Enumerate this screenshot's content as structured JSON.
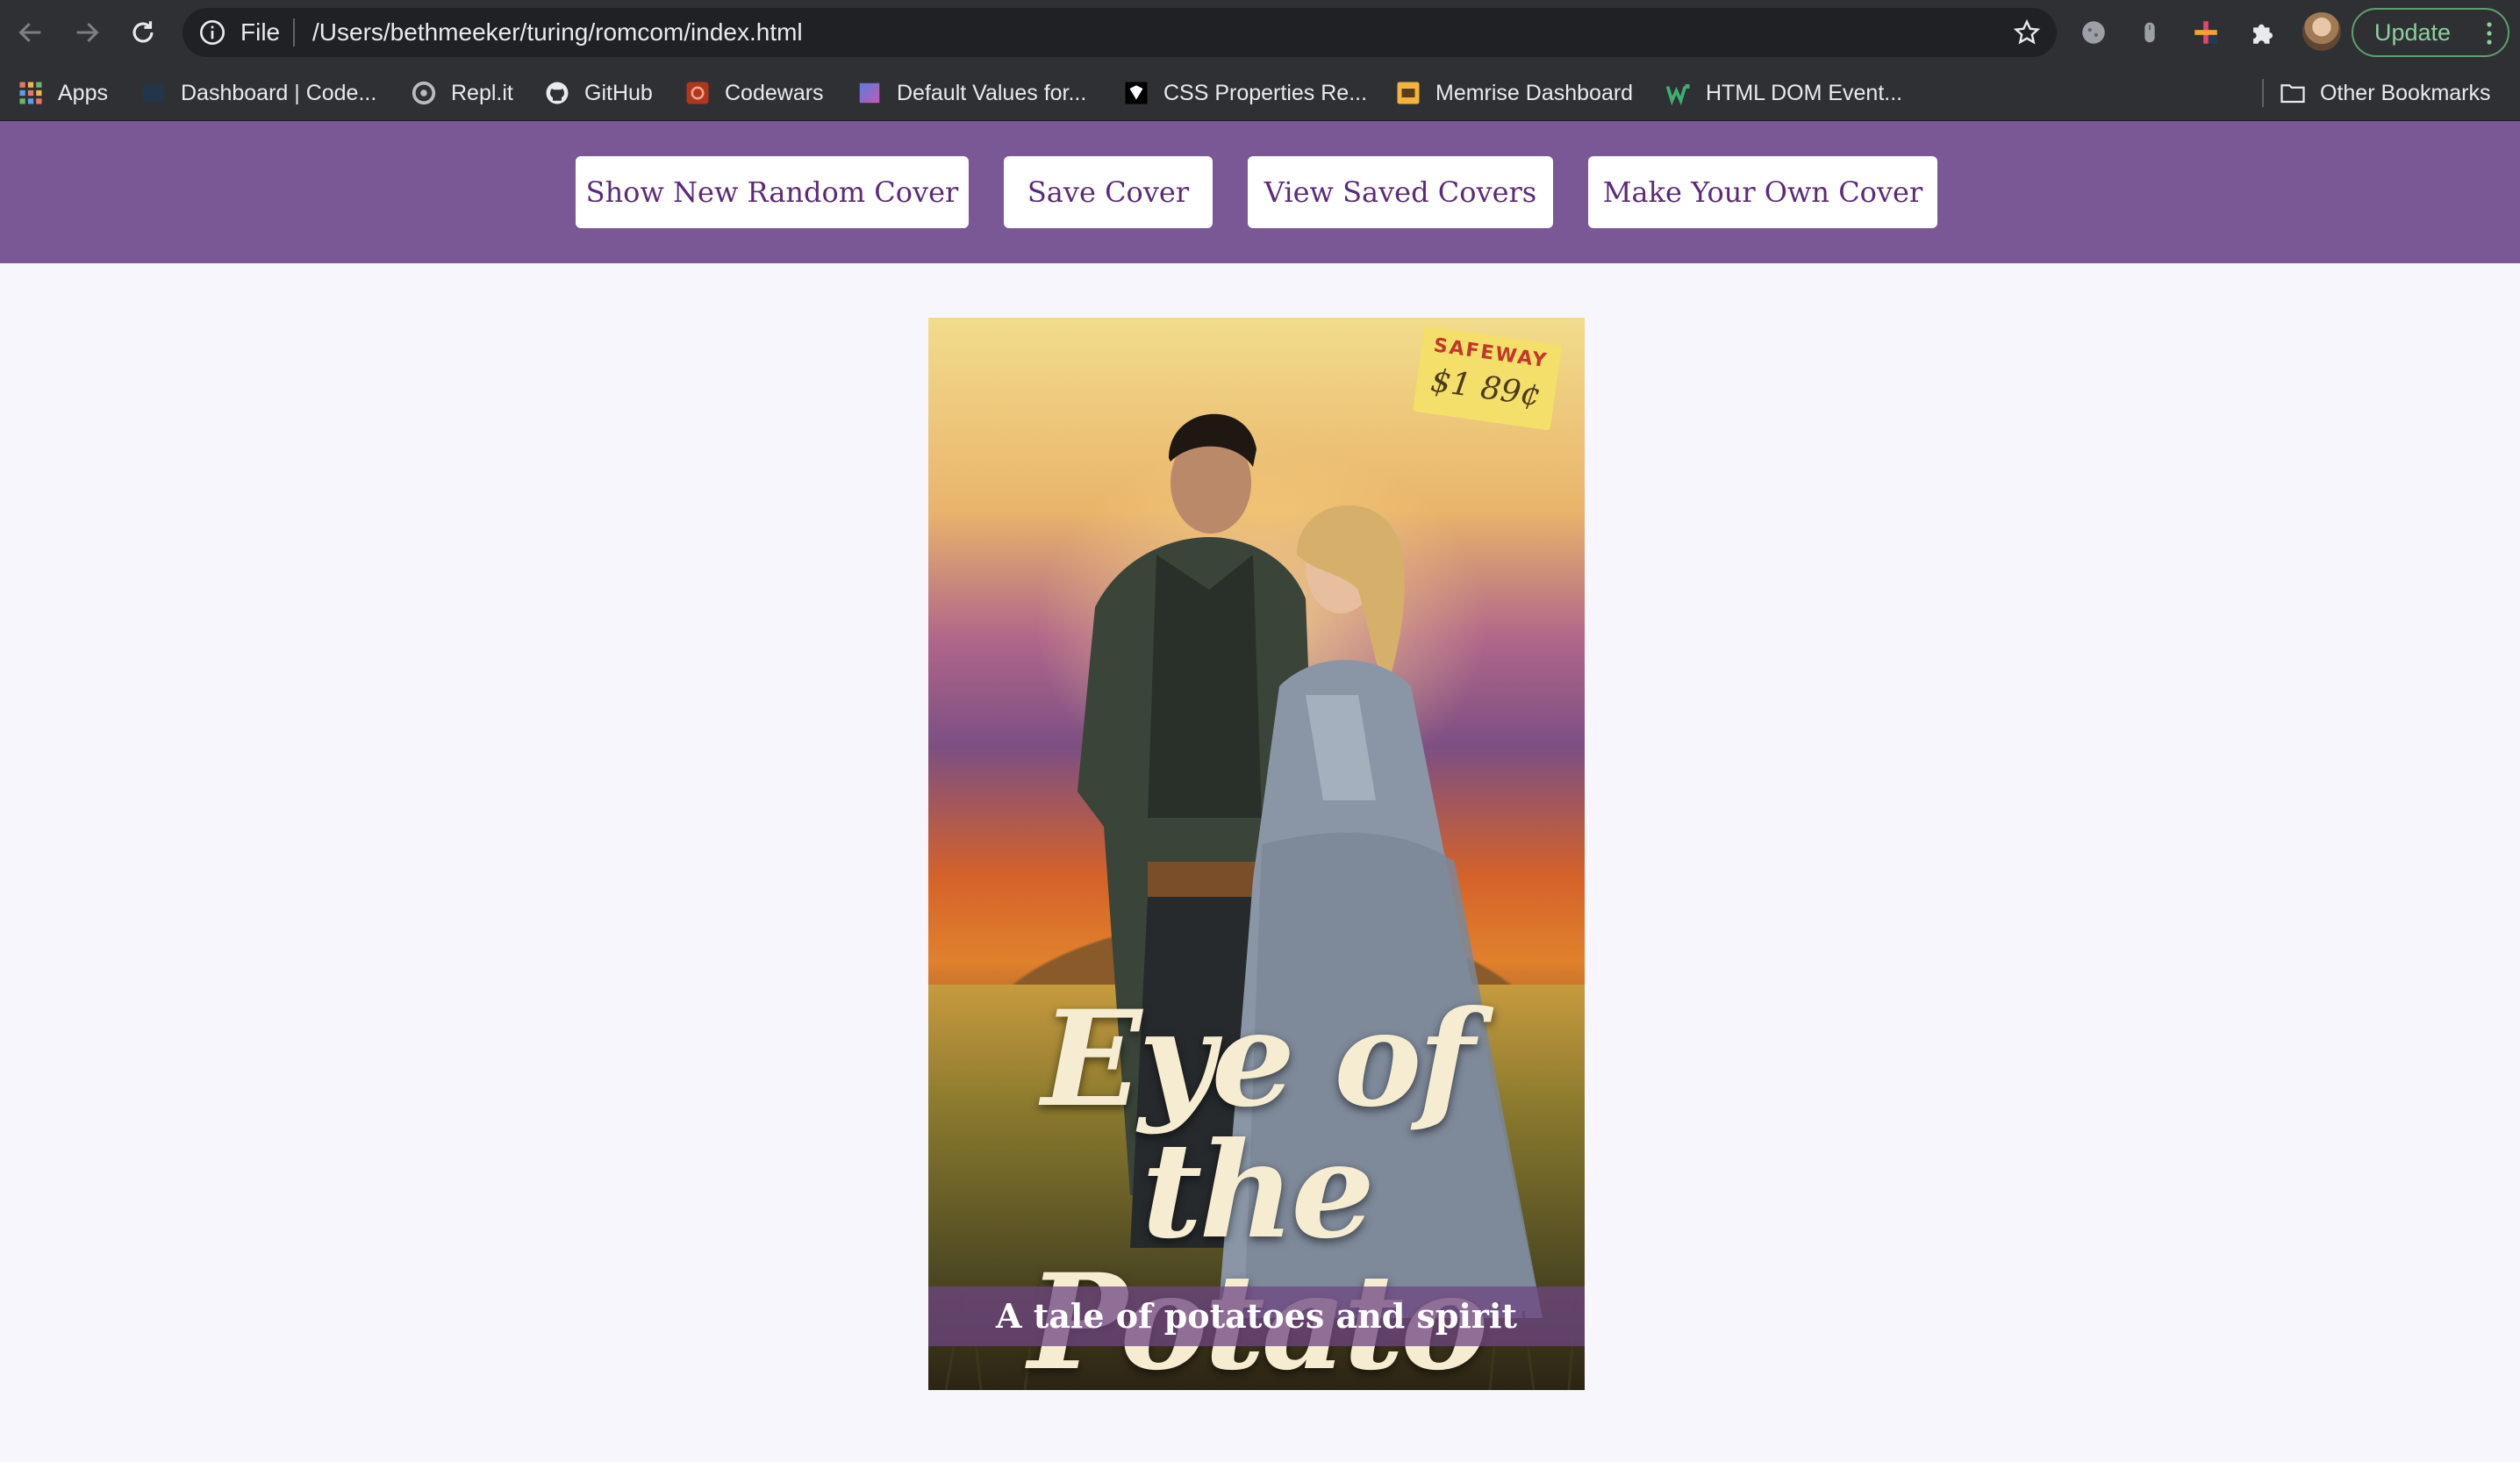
{
  "browser": {
    "address": {
      "scheme_label": "File",
      "url": "/Users/bethmeeker/turing/romcom/index.html"
    },
    "update_label": "Update",
    "extensions": [
      "cookie-icon",
      "mouse-icon",
      "plus-icon",
      "puzzle-icon"
    ],
    "bookmarks": [
      {
        "label": "Apps",
        "icon": "apps-grid-icon"
      },
      {
        "label": "Dashboard | Code...",
        "icon": "dashboard-icon"
      },
      {
        "label": "Repl.it",
        "icon": "replit-icon"
      },
      {
        "label": "GitHub",
        "icon": "github-icon"
      },
      {
        "label": "Codewars",
        "icon": "codewars-icon"
      },
      {
        "label": "Default Values for...",
        "icon": "page-icon"
      },
      {
        "label": "CSS Properties Re...",
        "icon": "css-icon"
      },
      {
        "label": "Memrise Dashboard",
        "icon": "memrise-icon"
      },
      {
        "label": "HTML DOM Event...",
        "icon": "w3-icon"
      }
    ],
    "other_bookmarks_label": "Other Bookmarks"
  },
  "app": {
    "nav": {
      "random_label": "Show New Random Cover",
      "save_label": "Save Cover",
      "view_saved_label": "View Saved Covers",
      "make_own_label": "Make Your Own Cover"
    },
    "cover": {
      "price_store": "SAFEWAY",
      "price_amount": "$1 89¢",
      "title": "Eye of the Potato",
      "tagline": "A tale of potatoes and spirit"
    }
  },
  "colors": {
    "header_purple": "#7a5895",
    "button_text": "#5b2a7a",
    "page_background": "#f7f6fc",
    "chrome_dark": "#2f3034",
    "update_green": "#8ccf9c"
  }
}
